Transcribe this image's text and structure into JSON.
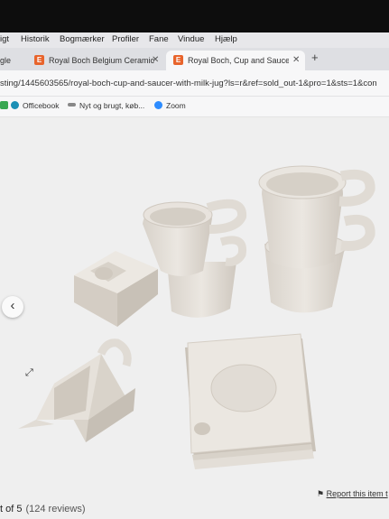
{
  "menubar": {
    "items": [
      "igt",
      "Historik",
      "Bogmærker",
      "Profiler",
      "Fane",
      "Vindue",
      "Hjælp"
    ]
  },
  "tabs": [
    {
      "label": "gle",
      "favicon": ""
    },
    {
      "label": "Royal Boch Belgium Ceramic",
      "favicon": "E"
    },
    {
      "label": "Royal Boch, Cup and Saucer",
      "favicon": "E"
    }
  ],
  "new_tab_symbol": "+",
  "close_symbol": "✕",
  "address": {
    "url": "sting/1445603565/royal-boch-cup-and-saucer-with-milk-jug?ls=r&ref=sold_out-1&pro=1&sts=1&con"
  },
  "bookmarks": [
    {
      "label": "",
      "icon": "green-folder-icon"
    },
    {
      "label": "Officebook",
      "icon": "officebook-icon"
    },
    {
      "label": "Nyt og brugt, køb...",
      "icon": "marketplace-icon"
    },
    {
      "label": "Zoom",
      "icon": "zoom-icon"
    }
  ],
  "gallery": {
    "prev_symbol": "‹",
    "expand_symbol": "⤢"
  },
  "report": {
    "flag_symbol": "⚑",
    "label": "Report this item t"
  },
  "rating": {
    "text": "t of 5",
    "reviews": "(124 reviews)"
  },
  "colors": {
    "accent_etsy": "#e8642c",
    "ceramic": "#e2ddd6",
    "background": "#efefef"
  }
}
